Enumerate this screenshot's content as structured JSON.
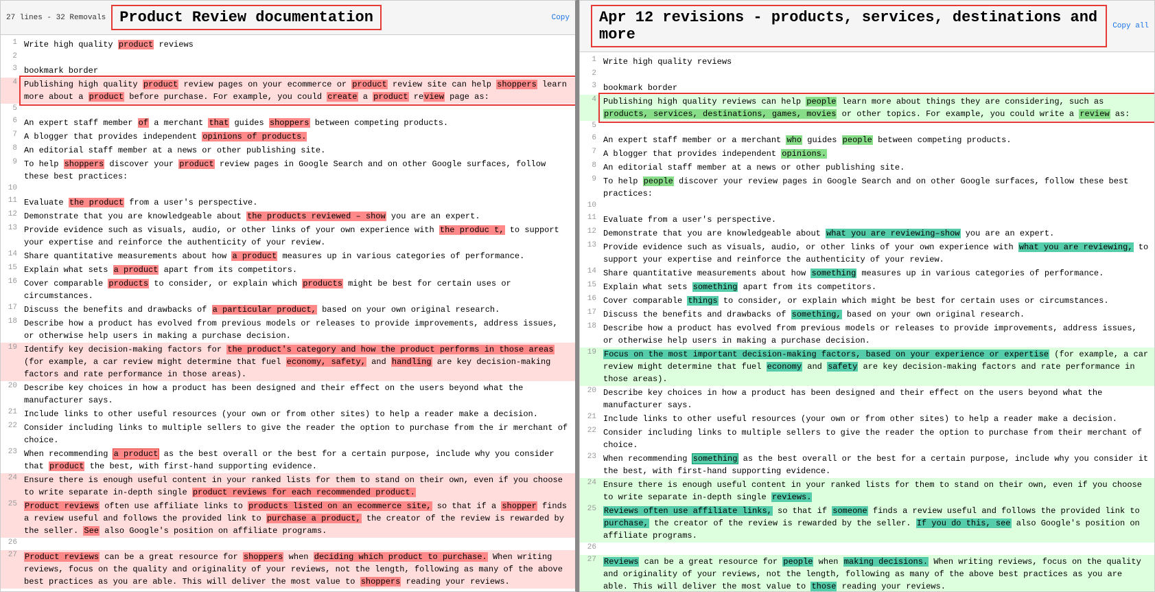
{
  "left_pane": {
    "stats": "27 lines  - 32 Removals",
    "title": "Product Review documentation",
    "copy_label": "Copy"
  },
  "right_pane": {
    "stats": "",
    "title": "Apr 12 revisions - products, services, destinations and more",
    "copy_label": "Copy all"
  }
}
